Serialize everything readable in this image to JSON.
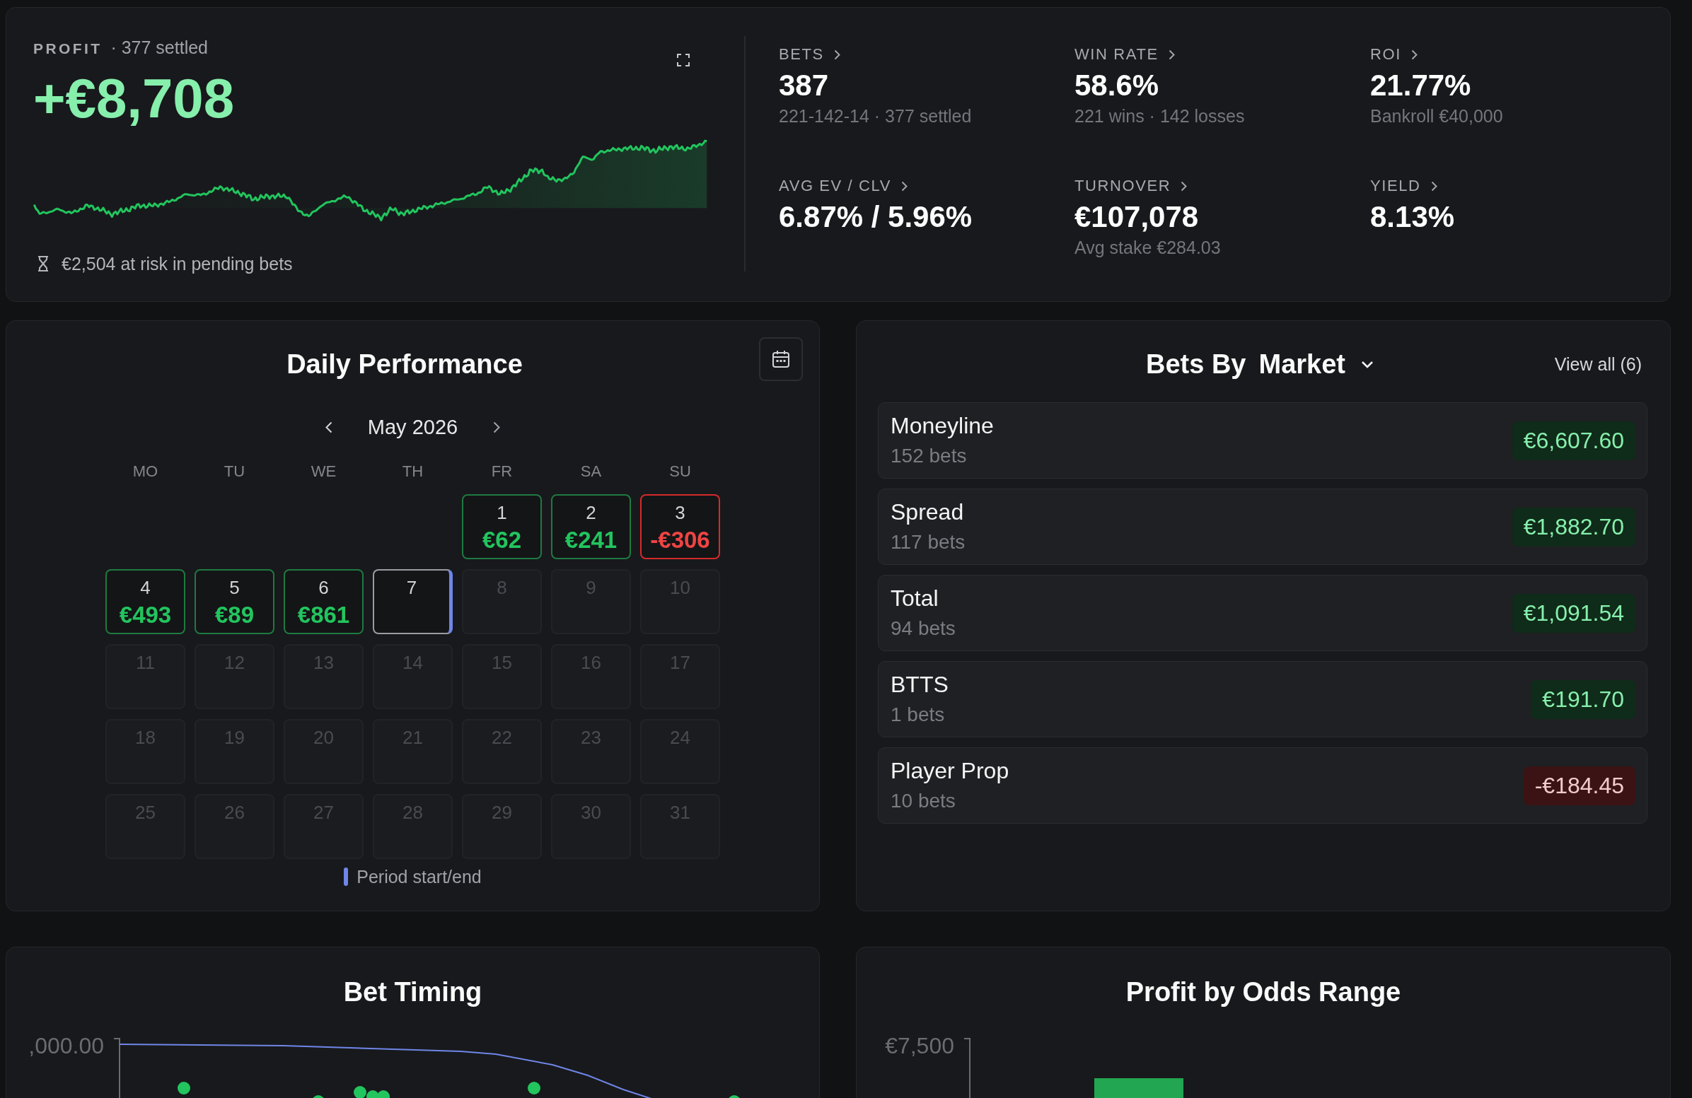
{
  "profit": {
    "label": "PROFIT",
    "settled": "· 377 settled",
    "value": "+€8,708",
    "at_risk": "€2,504 at risk in pending bets"
  },
  "stats": [
    {
      "label": "BETS",
      "value": "387",
      "sub": "221-142-14 · 377 settled"
    },
    {
      "label": "WIN RATE",
      "value": "58.6%",
      "sub": "221 wins · 142 losses"
    },
    {
      "label": "ROI",
      "value": "21.77%",
      "sub": "Bankroll €40,000"
    },
    {
      "label": "AVG EV / CLV",
      "value": "6.87% / 5.96%"
    },
    {
      "label": "TURNOVER",
      "value": "€107,078",
      "sub": "Avg stake €284.03"
    },
    {
      "label": "YIELD",
      "value": "8.13%"
    }
  ],
  "daily_performance": {
    "title": "Daily Performance",
    "month": "May 2026",
    "weekdays": [
      "MO",
      "TU",
      "WE",
      "TH",
      "FR",
      "SA",
      "SU"
    ],
    "weeks": [
      [
        {
          "day": "1",
          "amount": "€62",
          "kind": "win",
          "period_edge": false
        },
        {
          "day": "2",
          "amount": "€241",
          "kind": "win",
          "period_edge": false
        },
        {
          "day": "3",
          "amount": "-€306",
          "kind": "loss",
          "period_edge": false
        }
      ],
      [
        {
          "day": "4",
          "amount": "€493",
          "kind": "win",
          "period_edge": false
        },
        {
          "day": "5",
          "amount": "€89",
          "kind": "win",
          "period_edge": false
        },
        {
          "day": "6",
          "amount": "€861",
          "kind": "win",
          "period_edge": false
        },
        {
          "day": "7",
          "kind": "today",
          "period_edge": true
        },
        {
          "day": "8",
          "kind": "upcoming",
          "period_edge": false
        },
        {
          "day": "9",
          "kind": "upcoming",
          "period_edge": false
        },
        {
          "day": "10",
          "kind": "upcoming",
          "period_edge": false
        }
      ],
      [
        {
          "day": "11",
          "kind": "upcoming",
          "period_edge": false
        },
        {
          "day": "12",
          "kind": "upcoming",
          "period_edge": false
        },
        {
          "day": "13",
          "kind": "upcoming",
          "period_edge": false
        },
        {
          "day": "14",
          "kind": "upcoming",
          "period_edge": false
        },
        {
          "day": "15",
          "kind": "upcoming",
          "period_edge": false
        },
        {
          "day": "16",
          "kind": "upcoming",
          "period_edge": false
        },
        {
          "day": "17",
          "kind": "upcoming",
          "period_edge": false
        }
      ],
      [
        {
          "day": "18",
          "kind": "upcoming",
          "period_edge": false
        },
        {
          "day": "19",
          "kind": "upcoming",
          "period_edge": false
        },
        {
          "day": "20",
          "kind": "upcoming",
          "period_edge": false
        },
        {
          "day": "21",
          "kind": "upcoming",
          "period_edge": false
        },
        {
          "day": "22",
          "kind": "upcoming",
          "period_edge": false
        },
        {
          "day": "23",
          "kind": "upcoming",
          "period_edge": false
        },
        {
          "day": "24",
          "kind": "upcoming",
          "period_edge": false
        }
      ],
      [
        {
          "day": "25",
          "kind": "upcoming",
          "period_edge": false
        },
        {
          "day": "26",
          "kind": "upcoming",
          "period_edge": false
        },
        {
          "day": "27",
          "kind": "upcoming",
          "period_edge": false
        },
        {
          "day": "28",
          "kind": "upcoming",
          "period_edge": false
        },
        {
          "day": "29",
          "kind": "upcoming",
          "period_edge": false
        },
        {
          "day": "30",
          "kind": "upcoming",
          "period_edge": false
        },
        {
          "day": "31",
          "kind": "upcoming",
          "period_edge": false
        }
      ]
    ],
    "legend": "Period start/end"
  },
  "bets_by_market": {
    "title": "Bets By",
    "dropdown": "Market",
    "view_all": "View all (6)",
    "rows": [
      {
        "name": "Moneyline",
        "count": "152 bets",
        "amount": "€6,607.60",
        "kind": "positive"
      },
      {
        "name": "Spread",
        "count": "117 bets",
        "amount": "€1,882.70",
        "kind": "positive"
      },
      {
        "name": "Total",
        "count": "94 bets",
        "amount": "€1,091.54",
        "kind": "positive"
      },
      {
        "name": "BTTS",
        "count": "1 bets",
        "amount": "€191.70",
        "kind": "positive"
      },
      {
        "name": "Player Prop",
        "count": "10 bets",
        "amount": "-€184.45",
        "kind": "negative"
      }
    ]
  },
  "bet_timing": {
    "title": "Bet Timing",
    "y_tick": ",000.00"
  },
  "profit_by_odds_range": {
    "title": "Profit by Odds Range",
    "y_tick": "€7,500"
  }
}
